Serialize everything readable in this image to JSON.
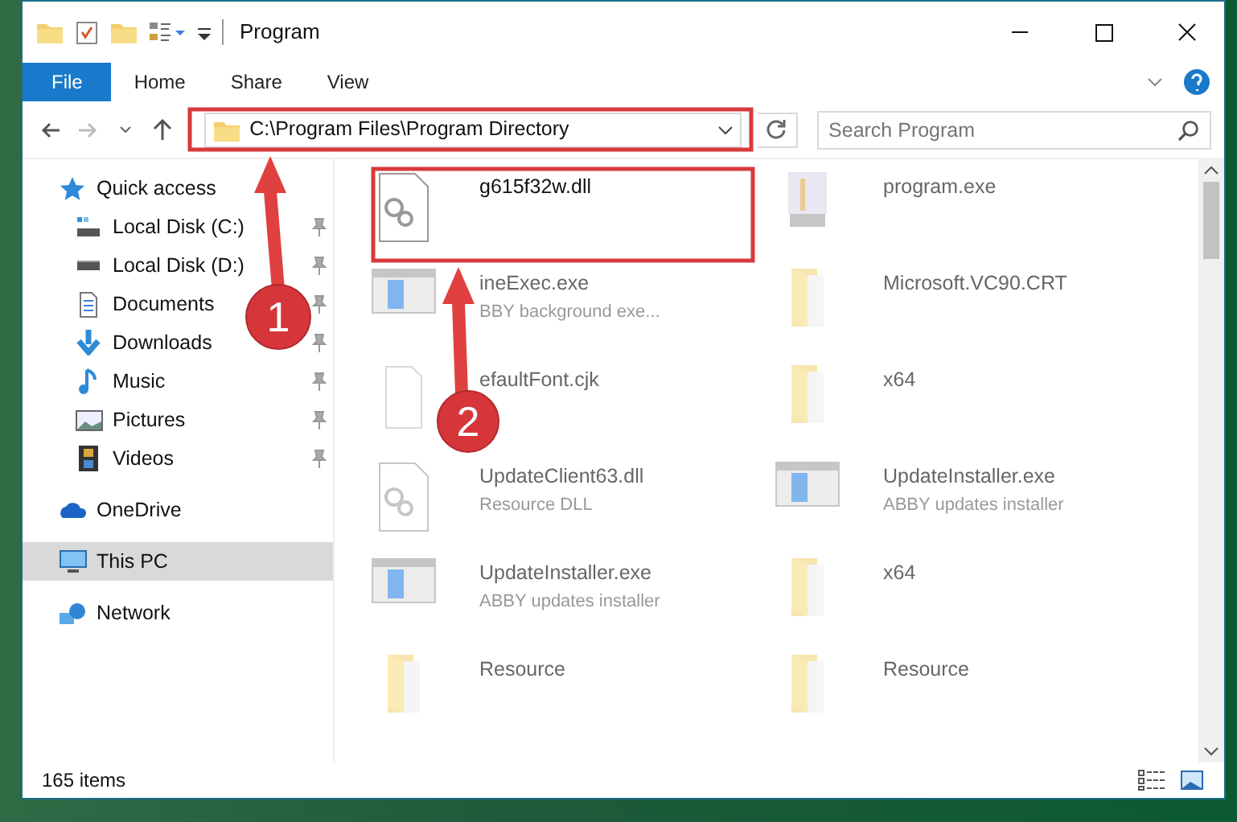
{
  "window": {
    "title": "Program"
  },
  "ribbon_tabs": [
    {
      "label": "File",
      "kind": "file",
      "selected": false
    },
    {
      "label": "Home",
      "kind": "tab",
      "selected": false
    },
    {
      "label": "Share",
      "kind": "tab",
      "selected": false
    },
    {
      "label": "View",
      "kind": "tab",
      "selected": false
    }
  ],
  "address": {
    "path": "C:\\Program Files\\Program Directory"
  },
  "search": {
    "placeholder": "Search Program"
  },
  "nav": [
    {
      "label": "Quick access",
      "kind": "star",
      "selected": false,
      "children": [
        {
          "label": "Local Disk (C:)",
          "kind": "disk-c",
          "pinned": true
        },
        {
          "label": "Local Disk (D:)",
          "kind": "disk",
          "pinned": true
        },
        {
          "label": "Documents",
          "kind": "documents",
          "pinned": true
        },
        {
          "label": "Downloads",
          "kind": "downloads",
          "pinned": true
        },
        {
          "label": "Music",
          "kind": "music",
          "pinned": true
        },
        {
          "label": "Pictures",
          "kind": "pictures",
          "pinned": true
        },
        {
          "label": "Videos",
          "kind": "videos",
          "pinned": true
        }
      ]
    },
    {
      "label": "OneDrive",
      "kind": "cloud",
      "selected": false
    },
    {
      "label": "This PC",
      "kind": "pc",
      "selected": true
    },
    {
      "label": "Network",
      "kind": "network",
      "selected": false
    }
  ],
  "files": [
    {
      "name": "g615f32w.dll",
      "kind": "dll",
      "blurred": false
    },
    {
      "name": "program.exe",
      "kind": "exe",
      "blurred": true
    },
    {
      "name": "ineExec.exe",
      "detail": "BBY background exe...",
      "kind": "app",
      "blurred": true
    },
    {
      "name": "Microsoft.VC90.CRT",
      "kind": "folder",
      "blurred": true
    },
    {
      "name": "efaultFont.cjk",
      "kind": "file",
      "blurred": true
    },
    {
      "name": "x64",
      "kind": "folder",
      "blurred": true
    },
    {
      "name": "UpdateClient63.dll",
      "detail": "Resource DLL",
      "kind": "dll",
      "blurred": true
    },
    {
      "name": "UpdateInstaller.exe",
      "detail": "ABBY updates installer",
      "kind": "app",
      "blurred": true
    },
    {
      "name": "UpdateInstaller.exe",
      "detail": "ABBY updates installer",
      "kind": "app",
      "blurred": true
    },
    {
      "name": "x64",
      "kind": "folder",
      "blurred": true
    },
    {
      "name": "Resource",
      "kind": "folder",
      "blurred": true
    },
    {
      "name": "Resource",
      "kind": "folder",
      "blurred": true
    }
  ],
  "status_bar": {
    "count": "165 items"
  },
  "callouts": [
    {
      "number": "1"
    },
    {
      "number": "2"
    }
  ]
}
